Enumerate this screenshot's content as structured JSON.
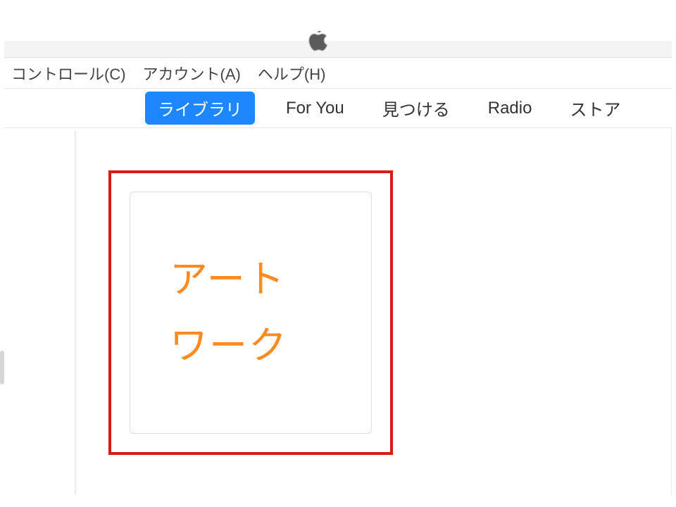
{
  "menubar": {
    "items": [
      {
        "label": "コントロール(C)"
      },
      {
        "label": "アカウント(A)"
      },
      {
        "label": "ヘルプ(H)"
      }
    ]
  },
  "tabs": {
    "items": [
      {
        "label": "ライブラリ",
        "active": true
      },
      {
        "label": "For You",
        "active": false
      },
      {
        "label": "見つける",
        "active": false
      },
      {
        "label": "Radio",
        "active": false
      },
      {
        "label": "ストア",
        "active": false
      }
    ]
  },
  "artwork": {
    "line1": "アート",
    "line2": "ワーク"
  },
  "highlight_color": "#d91818",
  "accent_text_color": "#ff8a1f"
}
